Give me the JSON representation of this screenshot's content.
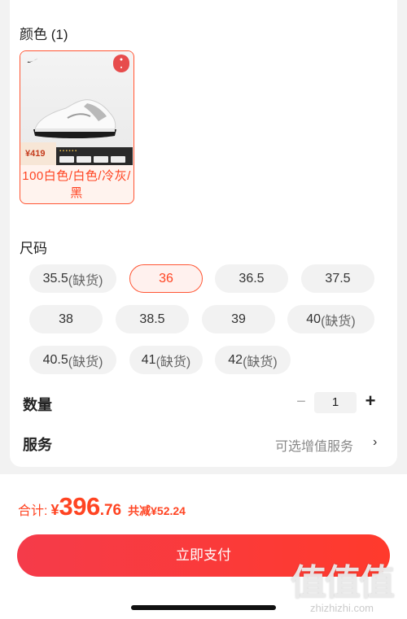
{
  "color_section": {
    "title": "颜色 (1)",
    "options": [
      {
        "label": "100白色/白色/冷灰/黑",
        "image_price": "¥419",
        "selected": true
      }
    ]
  },
  "size_section": {
    "title": "尺码",
    "sizes": [
      {
        "size": "35.5",
        "note": "(缺货)",
        "selected": false
      },
      {
        "size": "36",
        "note": "",
        "selected": true
      },
      {
        "size": "36.5",
        "note": "",
        "selected": false
      },
      {
        "size": "37.5",
        "note": "",
        "selected": false
      },
      {
        "size": "38",
        "note": "",
        "selected": false
      },
      {
        "size": "38.5",
        "note": "",
        "selected": false
      },
      {
        "size": "39",
        "note": "",
        "selected": false
      },
      {
        "size": "40",
        "note": "(缺货)",
        "selected": false
      },
      {
        "size": "40.5",
        "note": "(缺货)",
        "selected": false
      },
      {
        "size": "41",
        "note": "(缺货)",
        "selected": false
      },
      {
        "size": "42",
        "note": "(缺货)",
        "selected": false
      }
    ]
  },
  "quantity": {
    "label": "数量",
    "minus": "−",
    "value": "1",
    "plus": "+"
  },
  "service": {
    "label": "服务",
    "value": "可选增值服务",
    "chevron": "›"
  },
  "footer": {
    "total_label": "合计:",
    "currency": "¥",
    "total_integer": "396",
    "total_decimal": ".76",
    "discount": "共减¥52.24",
    "pay_button": "立即支付"
  },
  "watermark": {
    "logo": "值值值",
    "url": "zhizhizhi.com"
  },
  "colors": {
    "accent": "#ff4422",
    "selected_border": "#ff5533",
    "chip_bg": "#f2f2f2",
    "button_start": "#f53b4a",
    "button_end": "#ff3a2c"
  }
}
